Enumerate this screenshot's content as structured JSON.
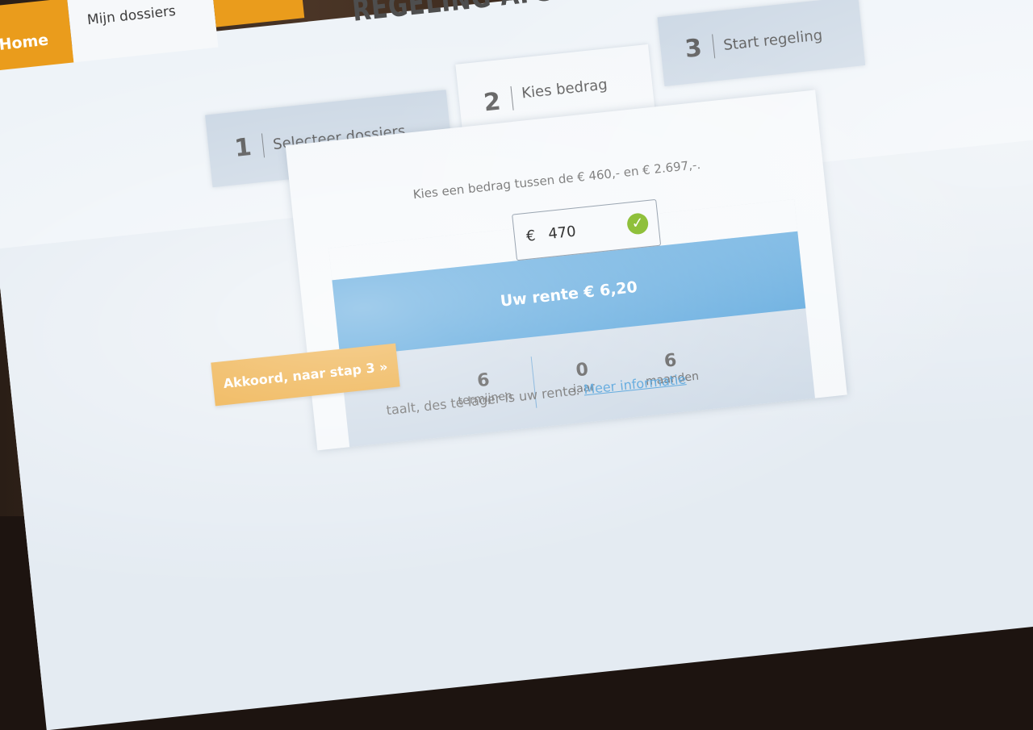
{
  "nav": {
    "home_label": "Home",
    "dossiers_label": "Mijn dossiers"
  },
  "page": {
    "title": "REGELING AFSPREKEN"
  },
  "steps": [
    {
      "number": "1",
      "label": "Selecteer dossiers"
    },
    {
      "number": "2",
      "label": "Kies bedrag"
    },
    {
      "number": "3",
      "label": "Start regeling"
    }
  ],
  "amount": {
    "hint": "Kies een bedrag tussen de € 460,- en € 2.697,-.",
    "currency": "€",
    "value": "470"
  },
  "interest": {
    "label": "Uw rente € 6,20"
  },
  "stats": [
    {
      "value": "6",
      "unit": "termijnen"
    },
    {
      "value": "0",
      "unit": "jaar"
    },
    {
      "value": "6",
      "unit": "maanden"
    }
  ],
  "accept_button": "Akkoord, naar stap 3 »",
  "footer": {
    "text": "taalt, des te lager is uw rente.",
    "link": "Meer informatie"
  },
  "colors": {
    "accent_orange": "#ea9c1c",
    "accent_blue": "#2f8fd4",
    "success_green": "#8fc03b"
  }
}
